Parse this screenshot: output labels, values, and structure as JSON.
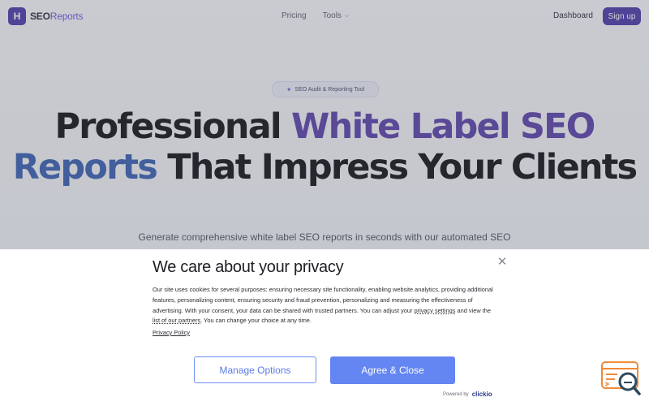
{
  "header": {
    "logo_letter": "H",
    "logo_brand": "SEO",
    "logo_accent": "Reports",
    "nav": [
      {
        "label": "Pricing"
      },
      {
        "label": "Tools"
      }
    ],
    "dashboard_label": "Dashboard",
    "signup_label": "Sign up"
  },
  "hero": {
    "badge": "SEO Audit & Reporting Tool",
    "headline_part1": "Professional ",
    "headline_part2": "White Label SEO",
    "headline_part3": "Reports",
    "headline_part4": " That Impress Your Clients",
    "subtitle": "Generate comprehensive white label SEO reports in seconds with our automated SEO"
  },
  "consent": {
    "title": "We care about your privacy",
    "body_1": "Our site uses cookies for several purposes: ensuring necessary site functionality, enabling website analytics, providing additional features, personalizing content, ensuring security and fraud prevention, personalizing and measuring the effectiveness of advertising. With your consent, your data can be shared with trusted partners. You can adjust your ",
    "privacy_settings_link": "privacy settings",
    "body_2": " and view the ",
    "partners_link": "list of our partners",
    "body_3": ". You can change your choice at any time.",
    "privacy_policy_link": "Privacy Policy",
    "manage_label": "Manage Options",
    "agree_label": "Agree & Close",
    "powered_by": "Powered by",
    "powered_brand": "clickio"
  },
  "colors": {
    "brand_purple": "#4b3aa8",
    "consent_blue": "#6486f3"
  },
  "icons": {
    "logo": "logo-mark-icon",
    "tools_chevron": "chevron-down-icon",
    "badge": "sparkle-icon",
    "close": "close-icon",
    "widget": "search-report-icon"
  }
}
